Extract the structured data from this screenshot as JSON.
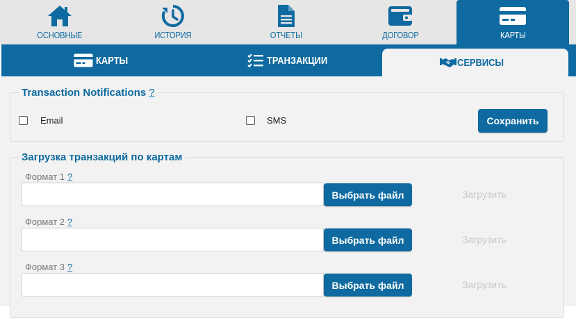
{
  "top_nav": {
    "items": [
      {
        "label": "ОСНОВНЫЕ",
        "icon": "home-icon"
      },
      {
        "label": "ИСТОРИЯ",
        "icon": "history-icon"
      },
      {
        "label": "ОТЧЕТЫ",
        "icon": "document-icon"
      },
      {
        "label": "ДОГОВОР",
        "icon": "wallet-icon"
      },
      {
        "label": "КАРТЫ",
        "icon": "credit-card-icon",
        "active": true
      }
    ]
  },
  "sub_nav": {
    "tabs": [
      {
        "label": "КАРТЫ",
        "icon": "credit-card-icon"
      },
      {
        "label": "ТРАНЗАКЦИИ",
        "icon": "checklist-icon"
      },
      {
        "label": "СЕРВИСЫ",
        "icon": "handshake-icon",
        "active": true
      }
    ]
  },
  "notifications": {
    "title": "Transaction Notifications",
    "help": "?",
    "email_label": "Email",
    "sms_label": "SMS",
    "save_label": "Сохранить"
  },
  "upload": {
    "title": "Загрузка транзакций по картам",
    "formats": [
      {
        "label": "Формат 1",
        "help": "?",
        "choose_label": "Выбрать файл",
        "upload_label": "Загрузить"
      },
      {
        "label": "Формат 2",
        "help": "?",
        "choose_label": "Выбрать файл",
        "upload_label": "Загрузить"
      },
      {
        "label": "Формат 3",
        "help": "?",
        "choose_label": "Выбрать файл",
        "upload_label": "Загрузить"
      }
    ]
  },
  "colors": {
    "primary": "#0e6aa0",
    "nav_background": "#e6e6e6",
    "content_background": "#f2f2f2",
    "disabled_text": "#c8c8c8"
  }
}
